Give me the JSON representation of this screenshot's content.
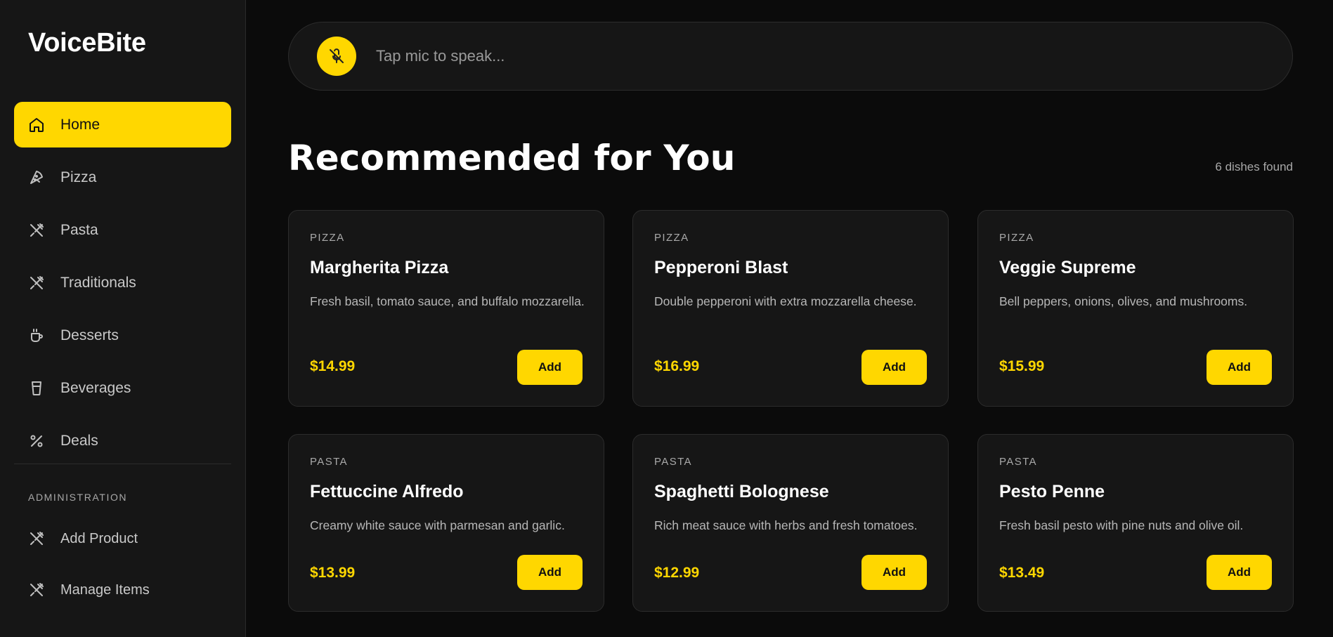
{
  "brand": "VoiceBite",
  "nav": [
    {
      "label": "Home",
      "icon": "home-icon",
      "active": true
    },
    {
      "label": "Pizza",
      "icon": "pizza-icon"
    },
    {
      "label": "Pasta",
      "icon": "utensils-icon"
    },
    {
      "label": "Traditionals",
      "icon": "utensils-icon"
    },
    {
      "label": "Desserts",
      "icon": "coffee-cup-icon"
    },
    {
      "label": "Beverages",
      "icon": "glass-icon"
    },
    {
      "label": "Deals",
      "icon": "percent-icon"
    }
  ],
  "admin": {
    "title": "ADMINISTRATION",
    "items": [
      {
        "label": "Add Product",
        "icon": "utensils-icon"
      },
      {
        "label": "Manage Items",
        "icon": "utensils-icon"
      }
    ]
  },
  "voice": {
    "placeholder": "Tap mic to speak...",
    "icon": "mic-off-icon"
  },
  "section": {
    "title": "Recommended for You",
    "count": "6 dishes found"
  },
  "dishes": [
    {
      "category": "PIZZA",
      "name": "Margherita Pizza",
      "description": "Fresh basil, tomato sauce, and buffalo mozzarella.",
      "price": "$14.99",
      "button": "Add"
    },
    {
      "category": "PIZZA",
      "name": "Pepperoni Blast",
      "description": "Double pepperoni with extra mozzarella cheese.",
      "price": "$16.99",
      "button": "Add"
    },
    {
      "category": "PIZZA",
      "name": "Veggie Supreme",
      "description": "Bell peppers, onions, olives, and mushrooms.",
      "price": "$15.99",
      "button": "Add"
    },
    {
      "category": "PASTA",
      "name": "Fettuccine Alfredo",
      "description": "Creamy white sauce with parmesan and garlic.",
      "price": "$13.99",
      "button": "Add"
    },
    {
      "category": "PASTA",
      "name": "Spaghetti Bolognese",
      "description": "Rich meat sauce with herbs and fresh tomatoes.",
      "price": "$12.99",
      "button": "Add"
    },
    {
      "category": "PASTA",
      "name": "Pesto Penne",
      "description": "Fresh basil pesto with pine nuts and olive oil.",
      "price": "$13.49",
      "button": "Add"
    }
  ],
  "colors": {
    "accent": "#ffd700",
    "background": "#0b0b0b",
    "surface": "#161616"
  }
}
